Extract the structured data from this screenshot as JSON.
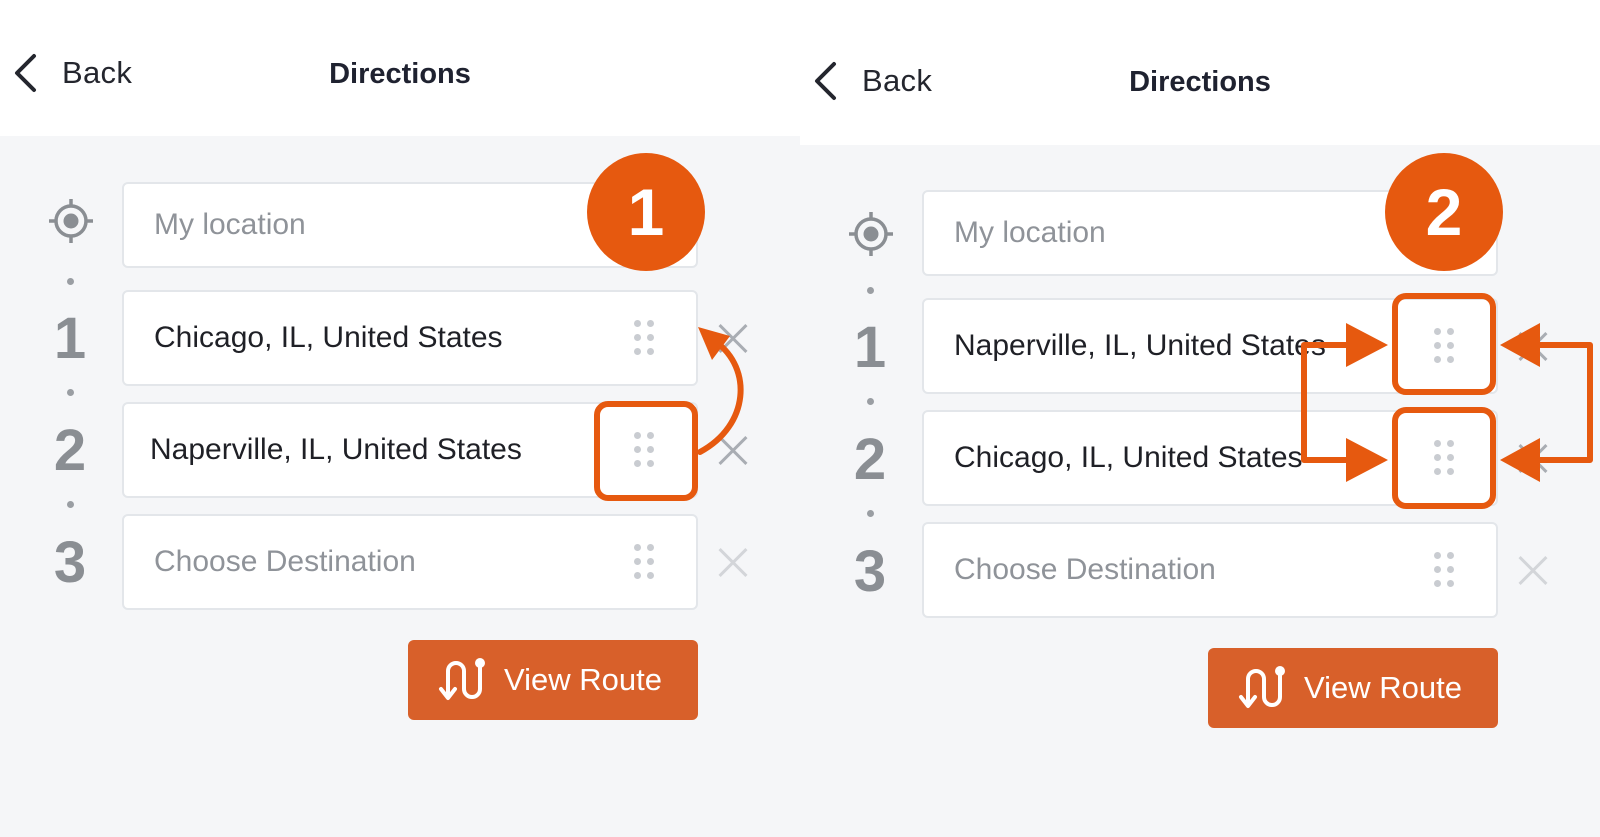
{
  "colors": {
    "accent": "#d8602a",
    "annotation": "#e6590f",
    "background": "#f5f6f8",
    "text": "#1f2026",
    "placeholder": "#8f9399"
  },
  "panels": [
    {
      "back_label": "Back",
      "title": "Directions",
      "badge": "1",
      "origin": {
        "text": "My location",
        "icon": "crosshair-icon"
      },
      "stops": [
        {
          "num": "1",
          "text": "Chicago, IL, United States",
          "is_placeholder": false
        },
        {
          "num": "2",
          "text": "Naperville, IL, United States",
          "is_placeholder": false
        },
        {
          "num": "3",
          "text": "Choose Destination",
          "is_placeholder": true
        }
      ],
      "view_route_label": "View Route",
      "view_route_icon": "route-icon"
    },
    {
      "back_label": "Back",
      "title": "Directions",
      "badge": "2",
      "origin": {
        "text": "My location",
        "icon": "crosshair-icon"
      },
      "stops": [
        {
          "num": "1",
          "text": "Naperville, IL, United States",
          "is_placeholder": false
        },
        {
          "num": "2",
          "text": "Chicago, IL, United States",
          "is_placeholder": false
        },
        {
          "num": "3",
          "text": "Choose Destination",
          "is_placeholder": true
        }
      ],
      "view_route_label": "View Route",
      "view_route_icon": "route-icon"
    }
  ]
}
